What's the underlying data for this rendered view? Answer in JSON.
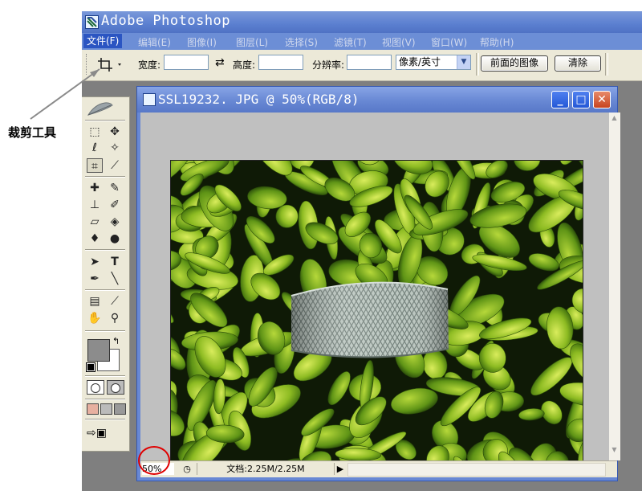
{
  "app": {
    "title": "Adobe Photoshop"
  },
  "menu": [
    {
      "label": "文件(F)",
      "active": true
    },
    {
      "label": "编辑(E)"
    },
    {
      "label": "图像(I)"
    },
    {
      "label": "图层(L)"
    },
    {
      "label": "选择(S)"
    },
    {
      "label": "滤镜(T)"
    },
    {
      "label": "视图(V)"
    },
    {
      "label": "窗口(W)"
    },
    {
      "label": "帮助(H)"
    }
  ],
  "options": {
    "width_label": "宽度:",
    "width_value": "",
    "height_label": "高度:",
    "height_value": "",
    "resolution_label": "分辨率:",
    "resolution_value": "",
    "unit_select": "像素/英寸",
    "front_image_button": "前面的图像",
    "clear_button": "清除"
  },
  "document": {
    "title": "SSL19232. JPG @ 50%(RGB/8)",
    "zoom": "50%",
    "doc_size": "文档:2.25M/2.25M"
  },
  "annotation": {
    "label": "裁剪工具"
  },
  "colors": {
    "titlebar": "#5b7fd0",
    "menubar": "#6c8ed6",
    "highlight_circle": "#e00000",
    "foreground": "#8c8c8c",
    "background": "#ffffff"
  },
  "icons": [
    "crop-icon",
    "swap-icon",
    "marquee-icon",
    "move-icon",
    "lasso-icon",
    "magic-wand-icon",
    "healing-icon",
    "brush-icon",
    "stamp-icon",
    "history-brush-icon",
    "eraser-icon",
    "bucket-icon",
    "blur-icon",
    "dodge-icon",
    "path-select-icon",
    "type-icon",
    "pen-icon",
    "line-icon",
    "notes-icon",
    "eyedropper-icon",
    "hand-icon",
    "zoom-icon"
  ]
}
